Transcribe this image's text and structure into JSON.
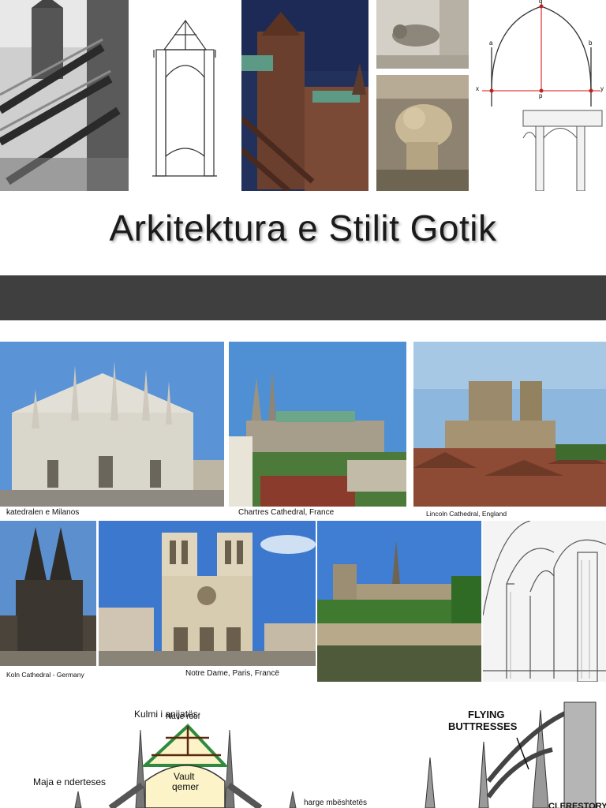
{
  "title": "Arkitektura e Stilit Gotik",
  "colors": {
    "band": "#3f3f3f",
    "sky": "#5d93d0",
    "stone": "#c9c0ad",
    "diagram_green": "#2e8b3e",
    "diagram_vault": "#fdf3c8"
  },
  "top_strip": {
    "arch_diagram_labels": {
      "q": "q",
      "a": "a",
      "b": "b",
      "x": "x",
      "y": "y",
      "p": "p"
    }
  },
  "cathedrals": [
    {
      "caption": "katedralen e Milanos"
    },
    {
      "caption": "Chartres Cathedral, France"
    },
    {
      "caption": "Lincoln Cathedral, England"
    },
    {
      "caption": "Koln Cathedral - Germany"
    },
    {
      "caption": "Notre Dame, Paris, Francë"
    }
  ],
  "cross_section": {
    "labels": {
      "roof": "Kulmi i anijatës",
      "nave_roof": "Nave roof",
      "vault": "Vault",
      "vault_alb": "qemer",
      "pinnacle": "Maja e nderteses",
      "buttress": "harge mbështetës"
    }
  },
  "flying_buttress": {
    "title_line1": "FLYING",
    "title_line2": "BUTTRESSES",
    "clerestory": "CLERESTORY"
  }
}
